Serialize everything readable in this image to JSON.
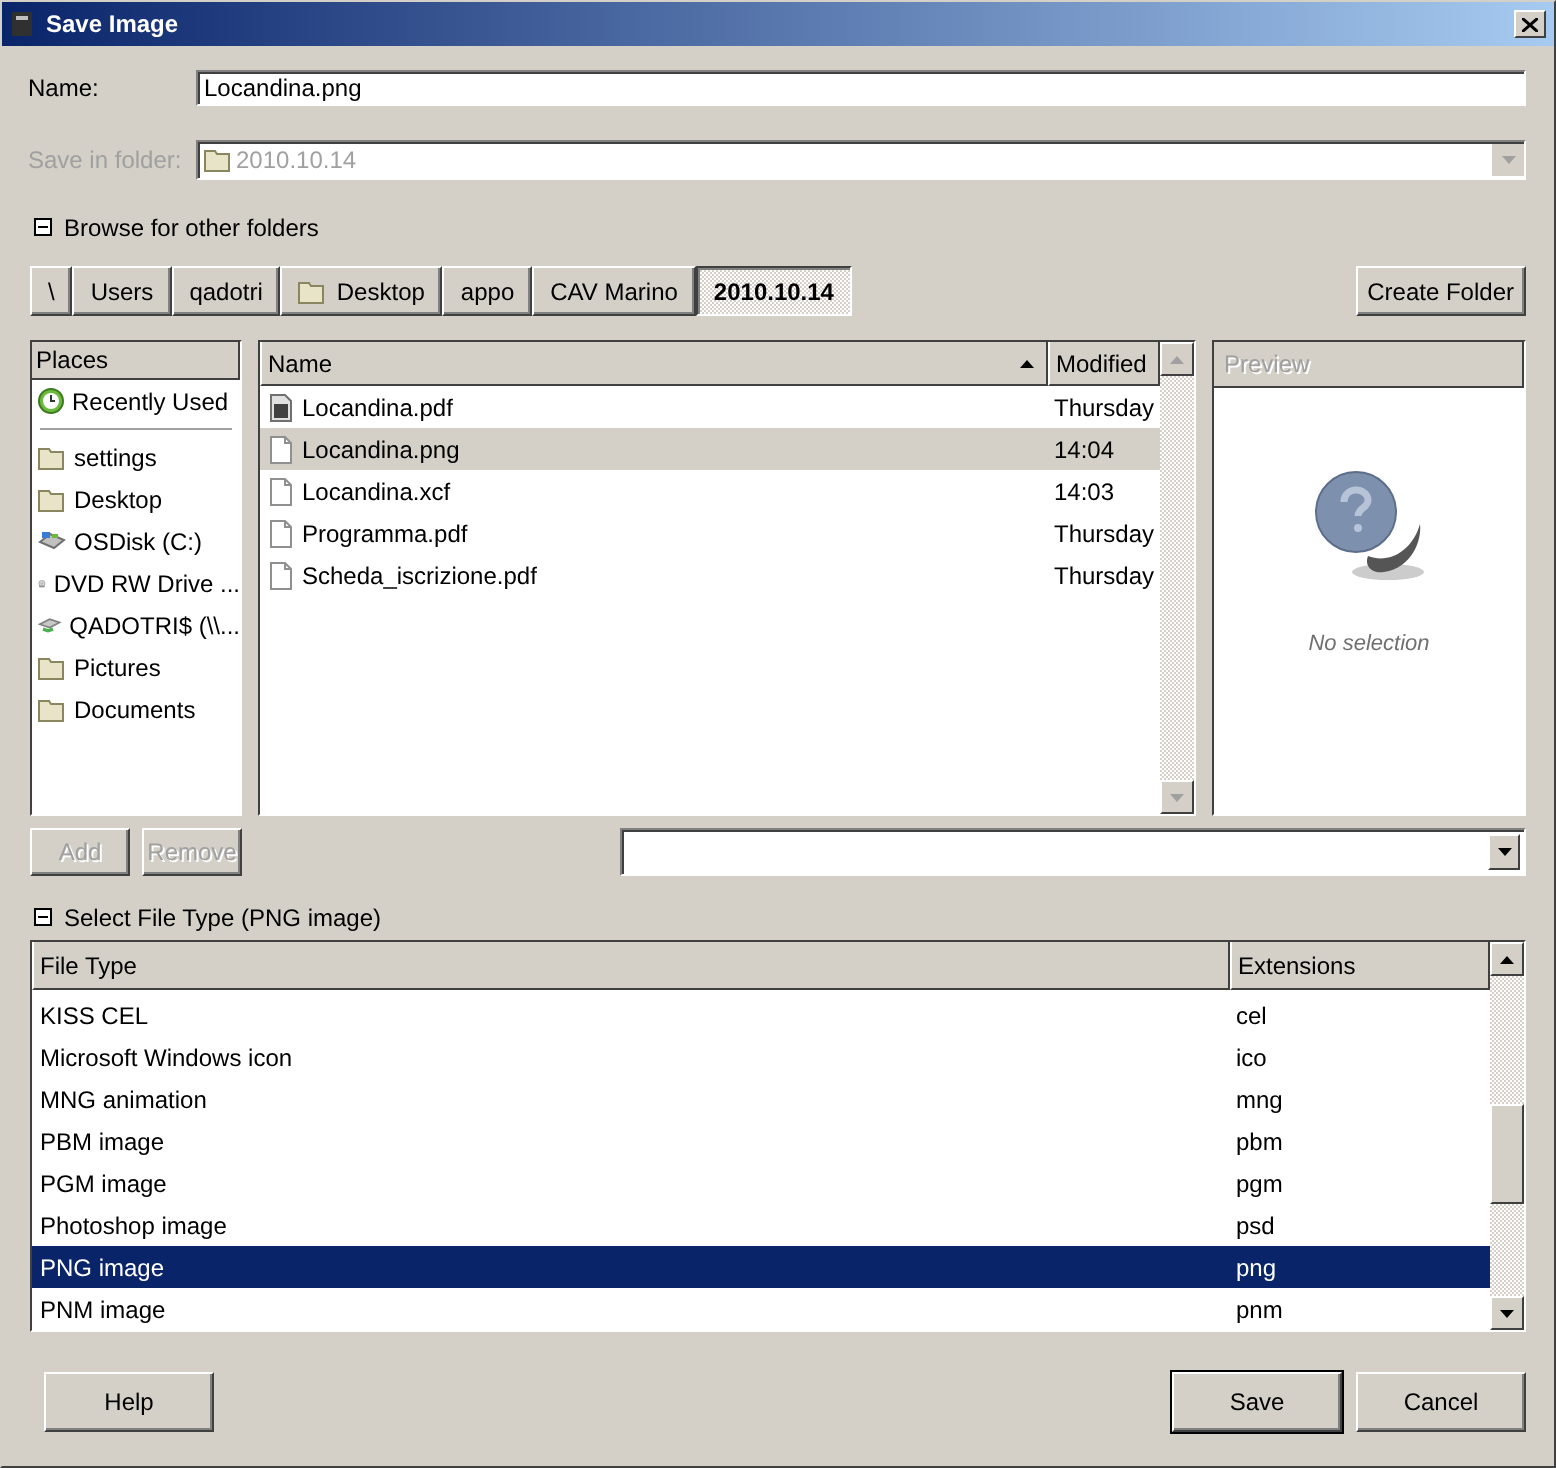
{
  "window": {
    "title": "Save Image"
  },
  "name_field": {
    "label": "Name:",
    "value": "Locandina.png"
  },
  "folder_field": {
    "label": "Save in folder:",
    "value": "2010.10.14",
    "disabled": true
  },
  "browse_toggle": {
    "label": "Browse for other folders",
    "expanded": true
  },
  "path_buttons": [
    {
      "label": "\\",
      "kind": "plain",
      "selected": false
    },
    {
      "label": "Users",
      "kind": "plain",
      "selected": false
    },
    {
      "label": "qadotri",
      "kind": "plain",
      "selected": false
    },
    {
      "label": "Desktop",
      "kind": "folder",
      "selected": false
    },
    {
      "label": "appo",
      "kind": "plain",
      "selected": false
    },
    {
      "label": "CAV Marino",
      "kind": "plain",
      "selected": false
    },
    {
      "label": "2010.10.14",
      "kind": "plain",
      "selected": true
    }
  ],
  "create_folder_button": "Create Folder",
  "places": {
    "header": "Places",
    "items": [
      {
        "label": "Recently Used",
        "kind": "recent"
      },
      {
        "label": "settings",
        "kind": "folder"
      },
      {
        "label": "Desktop",
        "kind": "folder"
      },
      {
        "label": "OSDisk (C:)",
        "kind": "disk"
      },
      {
        "label": "DVD RW Drive ...",
        "kind": "dvd"
      },
      {
        "label": "QADOTRI$ (\\\\...",
        "kind": "network"
      },
      {
        "label": "Pictures",
        "kind": "folder"
      },
      {
        "label": "Documents",
        "kind": "folder"
      }
    ]
  },
  "files": {
    "columns": [
      "Name",
      "Modified"
    ],
    "rows": [
      {
        "name": "Locandina.pdf",
        "modified": "Thursday",
        "kind": "pdf",
        "selected": false
      },
      {
        "name": "Locandina.png",
        "modified": "14:04",
        "kind": "doc",
        "selected": true
      },
      {
        "name": "Locandina.xcf",
        "modified": "14:03",
        "kind": "doc",
        "selected": false
      },
      {
        "name": "Programma.pdf",
        "modified": "Thursday",
        "kind": "doc",
        "selected": false
      },
      {
        "name": "Scheda_iscrizione.pdf",
        "modified": "Thursday",
        "kind": "doc",
        "selected": false
      }
    ]
  },
  "add_button": {
    "label": "Add",
    "disabled": true
  },
  "remove_button": {
    "label": "Remove",
    "disabled": true
  },
  "preview": {
    "header": "Preview",
    "disabled": true,
    "message": "No selection"
  },
  "file_type_toggle": {
    "label": "Select File Type (PNG image)",
    "expanded": true
  },
  "file_types": {
    "columns": [
      "File Type",
      "Extensions"
    ],
    "rows": [
      {
        "type": "KISS CEL",
        "extensions": "cel",
        "selected": false
      },
      {
        "type": "Microsoft Windows icon",
        "extensions": "ico",
        "selected": false
      },
      {
        "type": "MNG animation",
        "extensions": "mng",
        "selected": false
      },
      {
        "type": "PBM image",
        "extensions": "pbm",
        "selected": false
      },
      {
        "type": "PGM image",
        "extensions": "pgm",
        "selected": false
      },
      {
        "type": "Photoshop image",
        "extensions": "psd",
        "selected": false
      },
      {
        "type": "PNG image",
        "extensions": "png",
        "selected": true
      },
      {
        "type": "PNM image",
        "extensions": "pnm",
        "selected": false
      }
    ]
  },
  "buttons": [
    {
      "label": "Help",
      "default": false
    },
    {
      "label": "Save",
      "default": true
    },
    {
      "label": "Cancel",
      "default": false
    }
  ]
}
